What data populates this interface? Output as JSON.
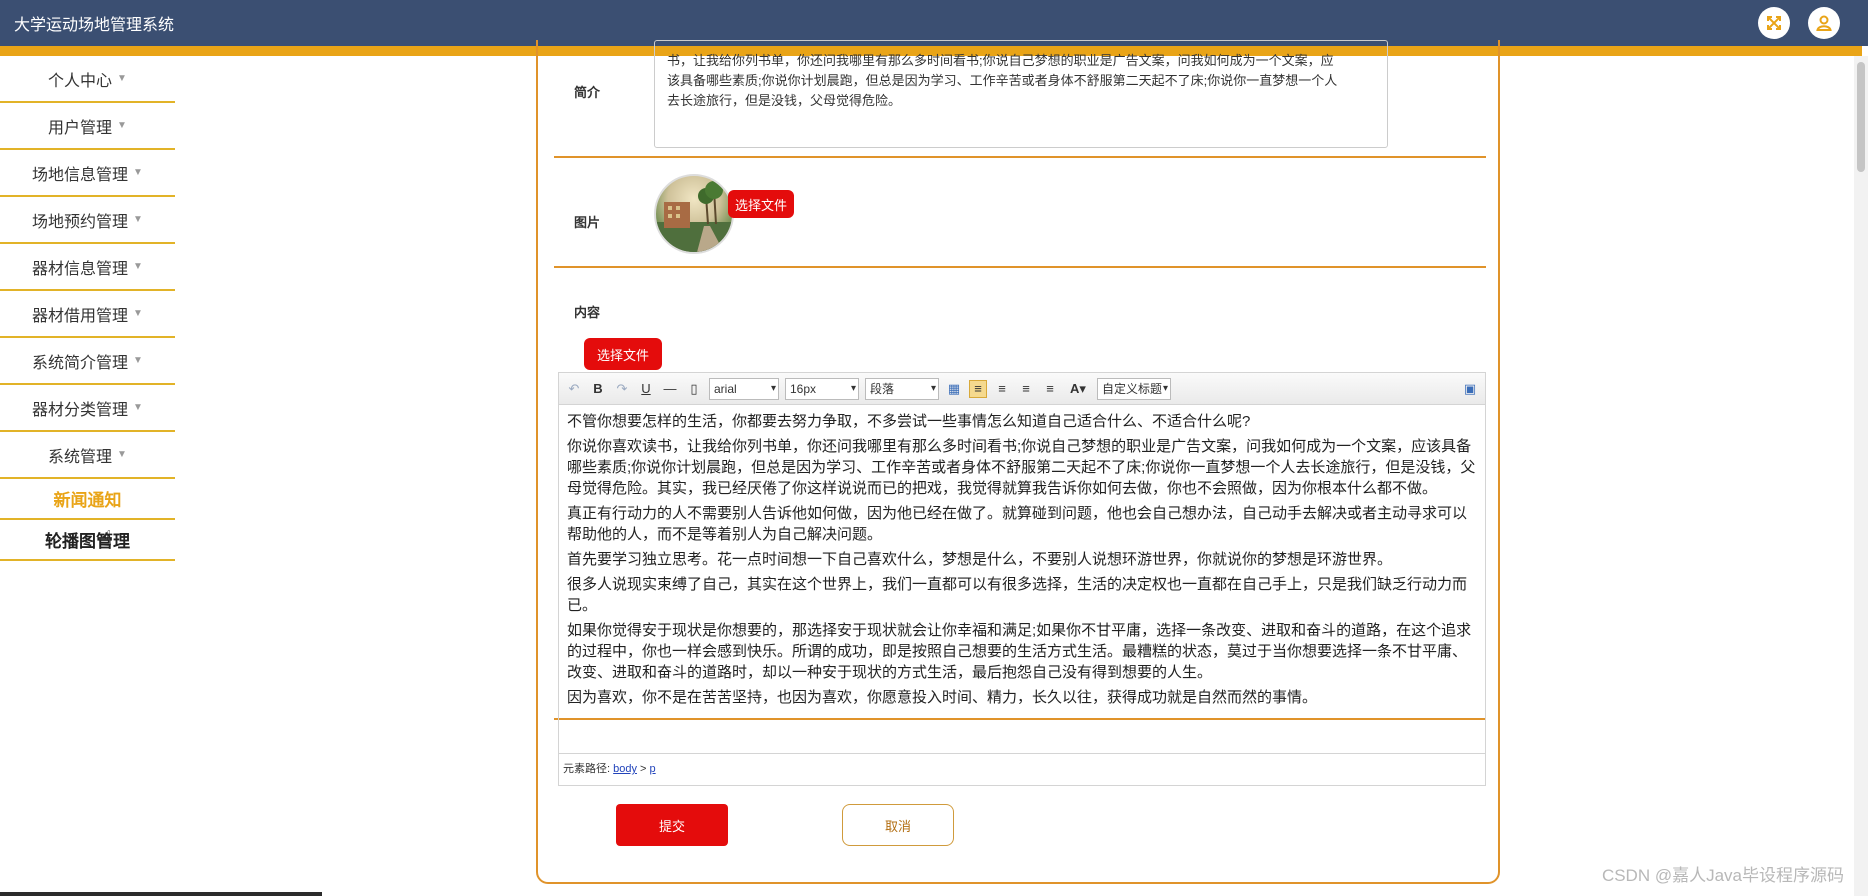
{
  "app": {
    "title": "大学运动场地管理系统"
  },
  "header": {
    "icons": [
      "expand-icon",
      "user-icon"
    ]
  },
  "sidebar": {
    "items": [
      {
        "label": "个人中心"
      },
      {
        "label": "用户管理"
      },
      {
        "label": "场地信息管理"
      },
      {
        "label": "场地预约管理"
      },
      {
        "label": "器材信息管理"
      },
      {
        "label": "器材借用管理"
      },
      {
        "label": "系统简介管理"
      },
      {
        "label": "器材分类管理"
      },
      {
        "label": "系统管理"
      }
    ],
    "subitems": [
      {
        "label": "新闻通知"
      },
      {
        "label": "轮播图管理"
      }
    ]
  },
  "form": {
    "intro_label": "简介",
    "intro_lines": [
      "书，让我给你列书单，你还问我哪里有那么多时间看书;你说自己梦想的职业是广告文案，问我如何成为一个文案，应",
      "该具备哪些素质;你说你计划晨跑，但总是因为学习、工作辛苦或者身体不舒服第二天起不了床;你说你一直梦想一个人",
      "去长途旅行，但是没钱，父母觉得危险。"
    ],
    "image_label": "图片",
    "image_button": "选择文件",
    "content_label": "内容",
    "content_button": "选择文件",
    "submit": "提交",
    "cancel": "取消"
  },
  "editor": {
    "font": "arial",
    "size": "16px",
    "paragraph": "段落",
    "custom_title": "自定义标题",
    "paragraphs": [
      "不管你想要怎样的生活，你都要去努力争取，不多尝试一些事情怎么知道自己适合什么、不适合什么呢?",
      "你说你喜欢读书，让我给你列书单，你还问我哪里有那么多时间看书;你说自己梦想的职业是广告文案，问我如何成为一个文案，应该具备哪些素质;你说你计划晨跑，但总是因为学习、工作辛苦或者身体不舒服第二天起不了床;你说你一直梦想一个人去长途旅行，但是没钱，父母觉得危险。其实，我已经厌倦了你这样说说而已的把戏，我觉得就算我告诉你如何去做，你也不会照做，因为你根本什么都不做。",
      "真正有行动力的人不需要别人告诉他如何做，因为他已经在做了。就算碰到问题，他也会自己想办法，自己动手去解决或者主动寻求可以帮助他的人，而不是等着别人为自己解决问题。",
      "首先要学习独立思考。花一点时间想一下自己喜欢什么，梦想是什么，不要别人说想环游世界，你就说你的梦想是环游世界。",
      "很多人说现实束缚了自己，其实在这个世界上，我们一直都可以有很多选择，生活的决定权也一直都在自己手上，只是我们缺乏行动力而已。",
      "如果你觉得安于现状是你想要的，那选择安于现状就会让你幸福和满足;如果你不甘平庸，选择一条改变、进取和奋斗的道路，在这个追求的过程中，你也一样会感到快乐。所谓的成功，即是按照自己想要的生活方式生活。最糟糕的状态，莫过于当你想要选择一条不甘平庸、改变、进取和奋斗的道路时，却以一种安于现状的方式生活，最后抱怨自己没有得到想要的人生。",
      "因为喜欢，你不是在苦苦坚持，也因为喜欢，你愿意投入时间、精力，长久以往，获得成功就是自然而然的事情。"
    ],
    "path_label": "元素路径:",
    "path_body": "body",
    "path_sep": ">",
    "path_p": "p"
  },
  "watermark": "CSDN @嘉人Java毕设程序源码"
}
